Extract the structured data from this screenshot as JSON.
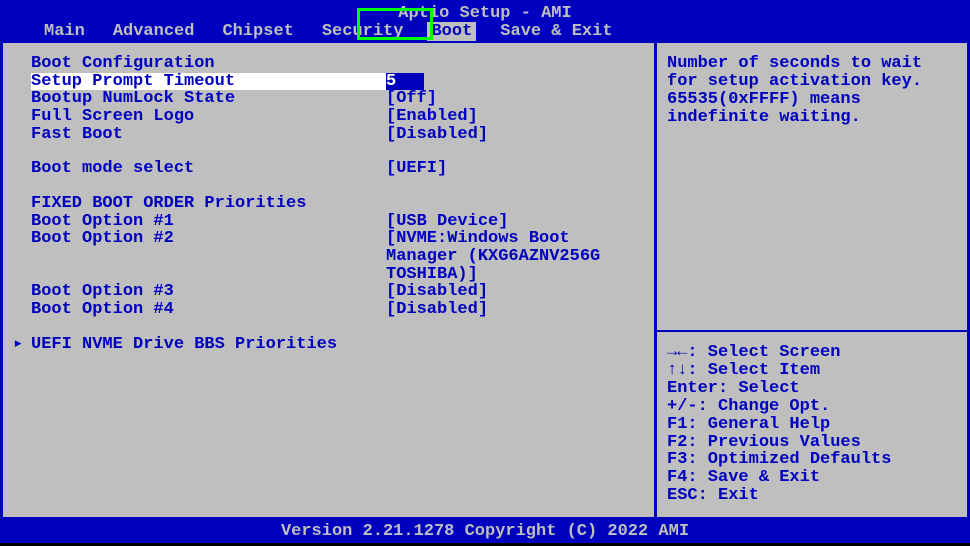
{
  "title": "Aptio Setup - AMI",
  "tabs": [
    "Main",
    "Advanced",
    "Chipset",
    "Security",
    "Boot",
    "Save & Exit"
  ],
  "active_tab": 4,
  "sections": {
    "boot_config_heading": "Boot Configuration",
    "setup_prompt_timeout": {
      "label": "Setup Prompt Timeout",
      "value": "5"
    },
    "numlock": {
      "label": "Bootup NumLock State",
      "value": "[Off]"
    },
    "fullscreen_logo": {
      "label": "Full Screen Logo",
      "value": "[Enabled]"
    },
    "fast_boot": {
      "label": "Fast Boot",
      "value": "[Disabled]"
    },
    "boot_mode": {
      "label": "Boot mode select",
      "value": "[UEFI]"
    },
    "fixed_order_heading": "FIXED BOOT ORDER Priorities",
    "opt1": {
      "label": "Boot Option #1",
      "value": "[USB Device]"
    },
    "opt2": {
      "label": "Boot Option #2",
      "value": "[NVME:Windows Boot",
      "extra1": "Manager (KXG6AZNV256G",
      "extra2": "TOSHIBA)]"
    },
    "opt3": {
      "label": "Boot Option #3",
      "value": "[Disabled]"
    },
    "opt4": {
      "label": "Boot Option #4",
      "value": "[Disabled]"
    },
    "submenu": "UEFI NVME Drive BBS Priorities"
  },
  "help_text": "Number of seconds to wait for setup activation key. 65535(0xFFFF) means indefinite waiting.",
  "keymap": [
    "→←: Select Screen",
    "↑↓: Select Item",
    "Enter: Select",
    "+/-: Change Opt.",
    "F1: General Help",
    "F2: Previous Values",
    "F3: Optimized Defaults",
    "F4: Save & Exit",
    "ESC: Exit"
  ],
  "footer": "Version 2.21.1278 Copyright (C) 2022 AMI"
}
